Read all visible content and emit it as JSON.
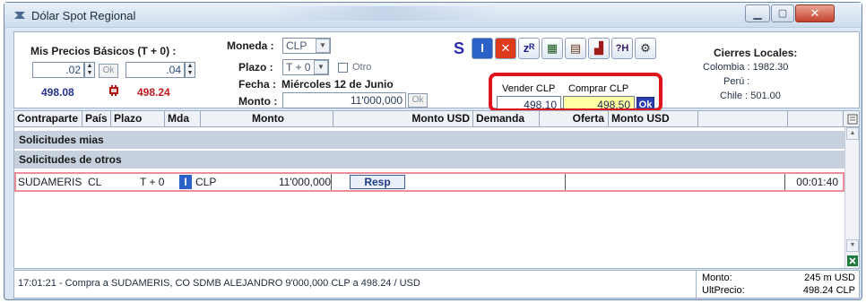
{
  "window": {
    "title": "Dólar Spot Regional"
  },
  "mis_precios": {
    "label": "Mis Precios Básicos (T + 0) :",
    "left_value": ".02",
    "right_value": ".04",
    "ok_label": "Ok",
    "buy_price": "498.08",
    "sell_price": "498.24"
  },
  "order_form": {
    "moneda_label": "Moneda :",
    "moneda_value": "CLP",
    "plazo_label": "Plazo :",
    "plazo_value": "T + 0",
    "otro_label": "Otro",
    "fecha_label": "Fecha :",
    "fecha_value": "Miércoles 12 de Junio",
    "monto_label": "Monto :",
    "monto_value": "11'000,000",
    "ok_label": "Ok"
  },
  "toolbar": {
    "tools": [
      {
        "name": "tool-s",
        "glyph": "S",
        "color": "#2a2ab0"
      },
      {
        "name": "tool-i",
        "glyph": "I",
        "color": "#ffffff"
      },
      {
        "name": "tool-x",
        "glyph": "✕",
        "color": "#ffffff"
      },
      {
        "name": "tool-zr",
        "glyph": "zᴿ",
        "color": "#1a1a8a"
      },
      {
        "name": "tool-cupos",
        "glyph": "▦",
        "color": "#1a5a1a"
      },
      {
        "name": "tool-book",
        "glyph": "▤",
        "color": "#6a3a1a"
      },
      {
        "name": "tool-chart",
        "glyph": "▟",
        "color": "#a01a1a"
      },
      {
        "name": "tool-h",
        "glyph": "?H",
        "color": "#3a1a6a"
      },
      {
        "name": "tool-settings",
        "glyph": "⚙",
        "color": "#2a2a2a"
      }
    ]
  },
  "prices": {
    "vender_label": "Vender CLP",
    "comprar_label": "Comprar CLP",
    "vender_value": "498.10",
    "comprar_value": "498.50",
    "ok_label": "Ok"
  },
  "cierres": {
    "title": "Cierres Locales:",
    "colombia": "Colombia : 1982.30",
    "peru": "Perú :",
    "chile": "Chile : 501.00"
  },
  "grid": {
    "columns": [
      "Contraparte",
      "País",
      "Plazo",
      "Mda",
      "Monto",
      "Monto USD",
      "Demanda",
      "Oferta",
      "Monto USD"
    ],
    "section_mine": "Solicitudes mias",
    "section_others": "Solicitudes de otros",
    "row": {
      "contraparte": "SUDAMERIS",
      "pais": "CL",
      "plazo": "T + 0",
      "badge": "I",
      "mda": "CLP",
      "monto": "11'000,000",
      "resp_label": "Resp",
      "time": "00:01:40"
    }
  },
  "status": {
    "message": "17:01:21 - Compra a SUDAMERIS, CO SDMB ALEJANDRO 9'000,000 CLP a  498.24 / USD",
    "monto_label": "Monto:",
    "monto_value": "245 m USD",
    "ultprecio_label": "UltPrecio:",
    "ultprecio_value": "498.24 CLP"
  }
}
